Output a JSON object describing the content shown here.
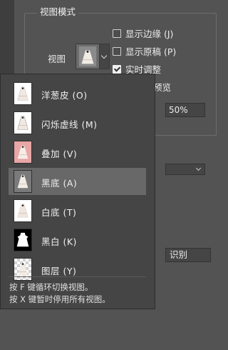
{
  "group": {
    "title": "视图模式",
    "view_label": "视图"
  },
  "options": {
    "show_edges": "显示边缘 (J)",
    "show_original": "显示原稿 (P)",
    "realtime": "实时调整",
    "show_edges_checked": false,
    "show_original_checked": false,
    "realtime_checked": true
  },
  "background_controls": {
    "partial_label": "预览",
    "percent": "50%",
    "identify_button": "识别"
  },
  "view_modes": [
    {
      "label": "洋葱皮 (O)",
      "icon": "onion-skin-thumb",
      "selected": false
    },
    {
      "label": "闪烁虚线 (M)",
      "icon": "marching-ants-thumb",
      "selected": false
    },
    {
      "label": "叠加 (V)",
      "icon": "overlay-thumb",
      "selected": false
    },
    {
      "label": "黑底 (A)",
      "icon": "on-black-thumb",
      "selected": true
    },
    {
      "label": "白底 (T)",
      "icon": "on-white-thumb",
      "selected": false
    },
    {
      "label": "黑白 (K)",
      "icon": "black-white-thumb",
      "selected": false
    },
    {
      "label": "图层 (Y)",
      "icon": "on-layers-thumb",
      "selected": false
    }
  ],
  "hints": {
    "line1": "按 F 键循环切换视图。",
    "line2": "按 X 键暂时停用所有视图。"
  },
  "colors": {
    "panel_bg": "#535353",
    "popup_bg": "#454545",
    "selected_bg": "#686868",
    "overlay_pink": "#e8a6a6"
  }
}
